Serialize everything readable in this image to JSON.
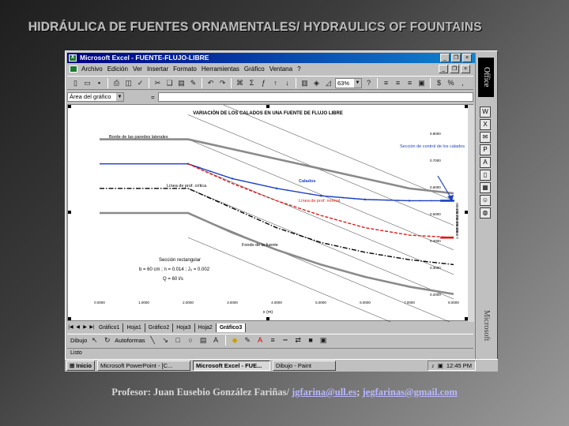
{
  "slide": {
    "title": "HIDRÁULICA DE FUENTES ORNAMENTALES/ HYDRAULICS OF FOUNTAINS",
    "footer_prefix": "Profesor: Juan Eusebio González Fariñas/ ",
    "email1": "jgfarina@ull.es",
    "separator": "; ",
    "email2": "jegfarinas@gmail.com"
  },
  "excel": {
    "title": "Microsoft Excel - FUENTE-FLUJO-LIBRE",
    "menu": [
      "Archivo",
      "Edición",
      "Ver",
      "Insertar",
      "Formato",
      "Herramientas",
      "Gráfico",
      "Ventana",
      "?"
    ],
    "zoom": "63%",
    "namebox": "Área del gráfico",
    "formula_eq": "=",
    "sheet_tabs": [
      "Gráfico1",
      "Hoja1",
      "Gráfico2",
      "Hoja3",
      "Hoja2",
      "Gráfico3"
    ],
    "draw_label": "Dibujo",
    "autoshapes": "Autoformas",
    "status": "Listo",
    "office_label": "Office",
    "microsoft_label": "Microsoft"
  },
  "taskbar": {
    "start": "Inicio",
    "items": [
      "Microsoft PowerPoint - [C...",
      "Microsoft Excel - FUE...",
      "Dibujo - Paint"
    ],
    "clock": "12:45 PM"
  },
  "chart_data": {
    "type": "line",
    "title": "VARIACIÓN DE LOS CALADOS EN UNA FUENTE DE FLUJO LIBRE",
    "xlabel": "x (m)",
    "ylabel": "",
    "x_ticks": [
      "0.0000",
      "1.0000",
      "2.0000",
      "3.0000",
      "4.0000",
      "5.0000",
      "6.0000",
      "7.0000",
      "8.0000"
    ],
    "y_ticks": [
      "0.8000",
      "0.7000",
      "0.6000",
      "0.5000",
      "0.4000",
      "0.3000",
      "0.2000"
    ],
    "right_ticks": [
      "1.0000",
      "0.8000",
      "0.6000",
      "0.4000",
      "0.2000"
    ],
    "xlim": [
      0,
      8
    ],
    "ylim": [
      0.15,
      0.85
    ],
    "series": [
      {
        "name": "Calados",
        "color": "#1e3fbf",
        "style": "solid-markers",
        "x": [
          0,
          2,
          3,
          4,
          5,
          6,
          7,
          8
        ],
        "y": [
          0.7,
          0.7,
          0.64,
          0.6,
          0.57,
          0.555,
          0.55,
          0.55
        ]
      },
      {
        "name": "Línea de prof. normal",
        "color": "#e01a1a",
        "style": "dash",
        "x": [
          2,
          3,
          4,
          5,
          6,
          7,
          8
        ],
        "y": [
          0.7,
          0.62,
          0.55,
          0.49,
          0.44,
          0.41,
          0.4
        ]
      },
      {
        "name": "Línea de prof. crítica",
        "color": "#000000",
        "style": "dashdot",
        "x": [
          0,
          2,
          3,
          4,
          5,
          6,
          7,
          8
        ],
        "y": [
          0.6,
          0.6,
          0.52,
          0.44,
          0.38,
          0.34,
          0.31,
          0.29
        ]
      },
      {
        "name": "Borde de las paredes laterales",
        "color": "#8a8a8a",
        "style": "thick",
        "x": [
          0,
          2,
          3,
          4,
          5,
          6,
          7,
          8
        ],
        "y": [
          0.8,
          0.8,
          0.76,
          0.72,
          0.68,
          0.64,
          0.6,
          0.58
        ]
      },
      {
        "name": "Fondo de la fuente",
        "color": "#8a8a8a",
        "style": "thick",
        "x": [
          0,
          2,
          3,
          4,
          5,
          6,
          7,
          8
        ],
        "y": [
          0.5,
          0.5,
          0.42,
          0.35,
          0.29,
          0.24,
          0.2,
          0.17
        ]
      }
    ],
    "annotations": {
      "walls": "Borde de las paredes laterales",
      "control": "Sección de control de los calados",
      "calados": "Calados",
      "critica": "Línea de prof. crítica",
      "normal": "Línea de prof. normal",
      "fondo": "Fondo de la fuente",
      "section": "Sección rectangular",
      "params1": "b = 60 cm ; n = 0.014 ; J₀ = 0.002",
      "params2": "Q = 60 l/s"
    }
  }
}
